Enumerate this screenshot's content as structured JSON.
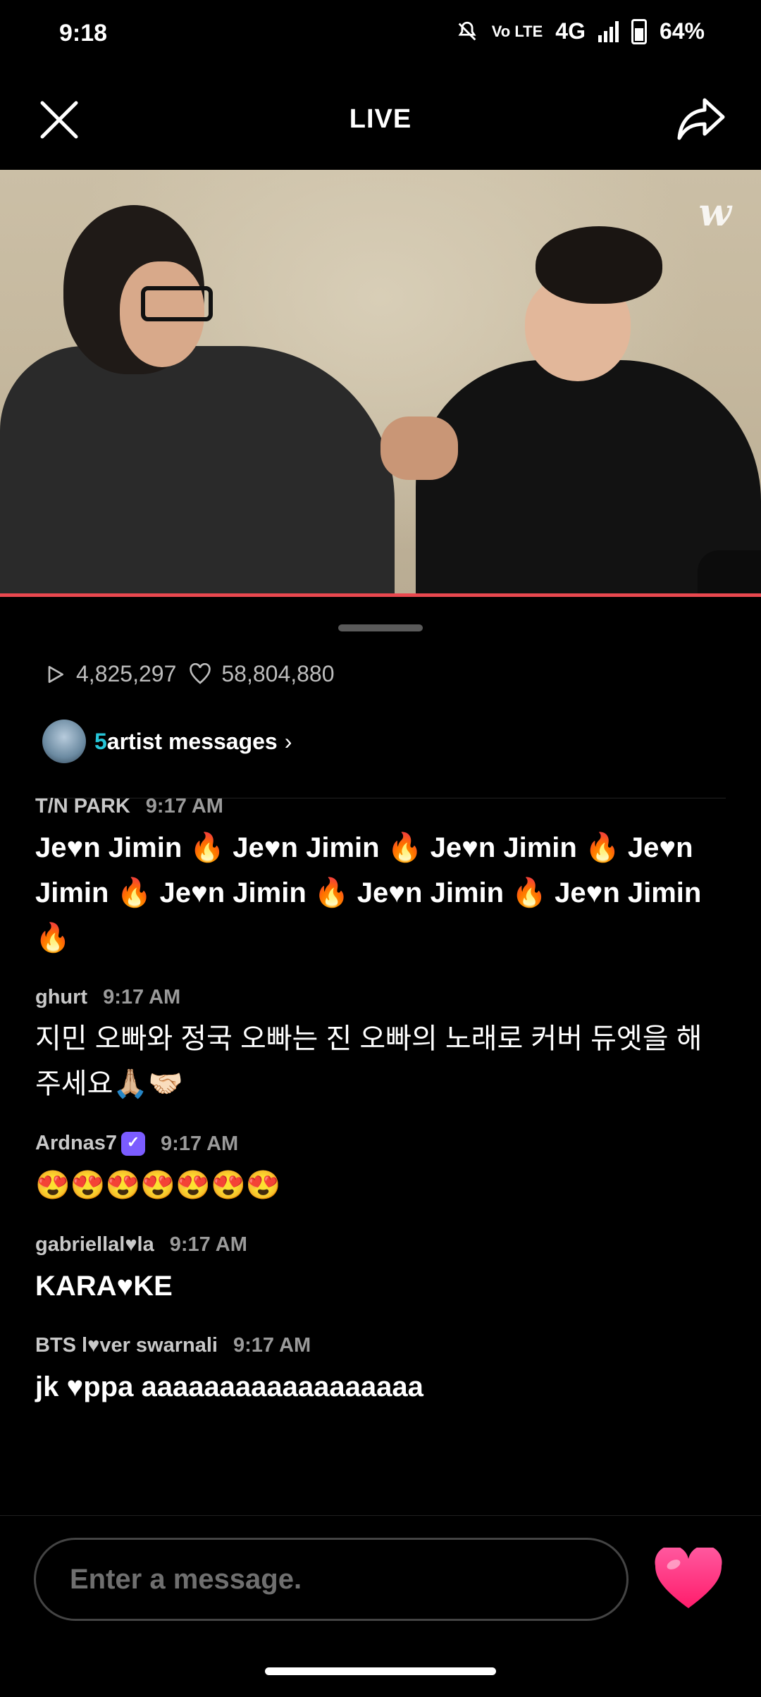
{
  "status_bar": {
    "time": "9:18",
    "network": "4G",
    "volte": "Vo LTE",
    "battery": "64%"
  },
  "header": {
    "title": "LIVE"
  },
  "video": {
    "watermark": "w",
    "progress": 1.0
  },
  "stats": {
    "plays": "4,825,297",
    "likes": "58,804,880"
  },
  "artist_messages": {
    "count": "5",
    "label": "artist messages"
  },
  "chat": [
    {
      "user": "T/N PARK",
      "time": "9:17 AM",
      "text": "Je♥n Jimin 🔥 Je♥n Jimin 🔥 Je♥n Jimin 🔥 Je♥n Jimin 🔥 Je♥n Jimin 🔥 Je♥n Jimin 🔥 Je♥n Jimin 🔥"
    },
    {
      "user": "ghurt",
      "time": "9:17 AM",
      "text": "지민 오빠와 정국 오빠는 진 오빠의 노래로 커버 듀엣을 해주세요🙏🏼🤝🏻"
    },
    {
      "user": "Ardnas7",
      "time": "9:17 AM",
      "text": "😍😍😍😍😍😍😍",
      "verified": true
    },
    {
      "user": "gabriellal♥la",
      "time": "9:17 AM",
      "text": "KARA♥KE"
    },
    {
      "user": "BTS l♥ver swarnali",
      "time": "9:17 AM",
      "text": "jk ♥ppa aaaaaaaaaaaaaaaaaa"
    }
  ],
  "input": {
    "placeholder": "Enter a message."
  },
  "colors": {
    "accent_cyan": "#27c6d9",
    "progress_red": "#e9484f",
    "heart_pink": "#ff2d7a"
  }
}
